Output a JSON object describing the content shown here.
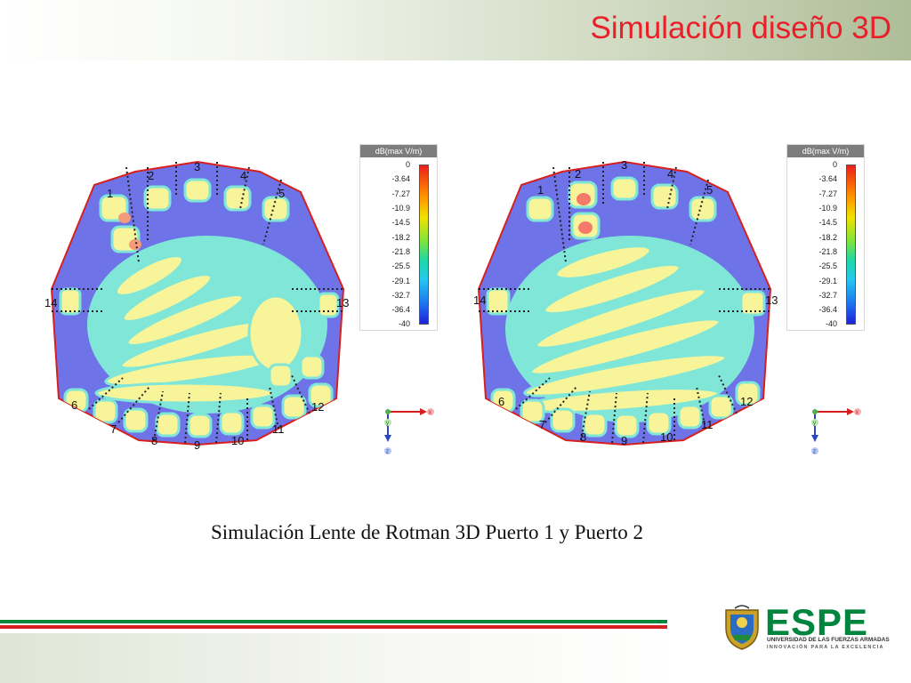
{
  "slide": {
    "title": "Simulación diseño 3D"
  },
  "figure": {
    "caption": "Simulación Lente de Rotman 3D Puerto 1 y Puerto 2",
    "color_scale": {
      "header": "dB(max V/m)",
      "ticks": [
        "0",
        "-3.64",
        "-7.27",
        "-10.9",
        "-14.5",
        "-18.2",
        "-21.8",
        "-25.5",
        "-29.1",
        "-32.7",
        "-36.4",
        "-40"
      ]
    },
    "axes": {
      "x": "x",
      "y": "y",
      "z": "z"
    },
    "simulations": [
      {
        "ports": [
          "1",
          "2",
          "3",
          "4",
          "5",
          "6",
          "7",
          "8",
          "9",
          "10",
          "11",
          "12",
          "13",
          "14"
        ],
        "excited_port": "1"
      },
      {
        "ports": [
          "1",
          "2",
          "3",
          "4",
          "5",
          "6",
          "7",
          "8",
          "9",
          "10",
          "11",
          "12",
          "13",
          "14"
        ],
        "excited_port": "2"
      }
    ]
  },
  "logo": {
    "name": "ESPE",
    "line1": "UNIVERSIDAD DE LAS FUERZAS ARMADAS",
    "line2": "INNOVACIÓN PARA LA EXCELENCIA"
  },
  "colors": {
    "title": "#e8202a",
    "field_background": "#6f73e8",
    "field_low": "#7fe6d8",
    "field_mid": "#f7f49a",
    "field_high": "#e8201c",
    "brand_green": "#00853e",
    "brand_red": "#d6201f"
  }
}
